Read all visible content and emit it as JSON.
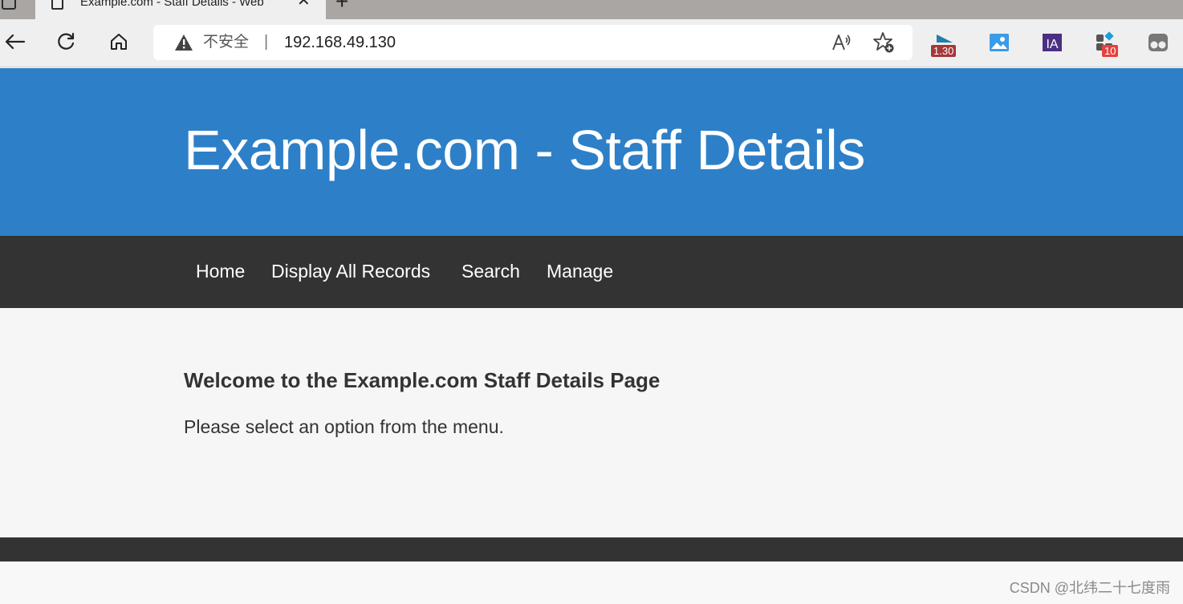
{
  "browser": {
    "tab_title": "Example.com - Staff Details - Web",
    "new_tab_symbol": "+",
    "close_symbol": "✕",
    "security_label": "不安全",
    "separator": "|",
    "url": "192.168.49.130",
    "extensions": [
      {
        "name": "extension-1",
        "badge": "1.30",
        "badge_color": "#a4373a"
      },
      {
        "name": "extension-image",
        "badge": ""
      },
      {
        "name": "extension-ia",
        "label": "IA"
      },
      {
        "name": "extension-apps",
        "badge": "10",
        "badge_color": "#e8413c"
      },
      {
        "name": "extension-profile",
        "badge": ""
      }
    ]
  },
  "site": {
    "title": "Example.com - Staff Details",
    "header_color": "#2d80c8",
    "nav_color": "#333333",
    "nav": [
      "Home",
      "Display All Records",
      "Search",
      "Manage"
    ],
    "heading": "Welcome to the Example.com Staff Details Page",
    "body": "Please select an option from the menu."
  },
  "watermark": "CSDN @北纬二十七度雨"
}
